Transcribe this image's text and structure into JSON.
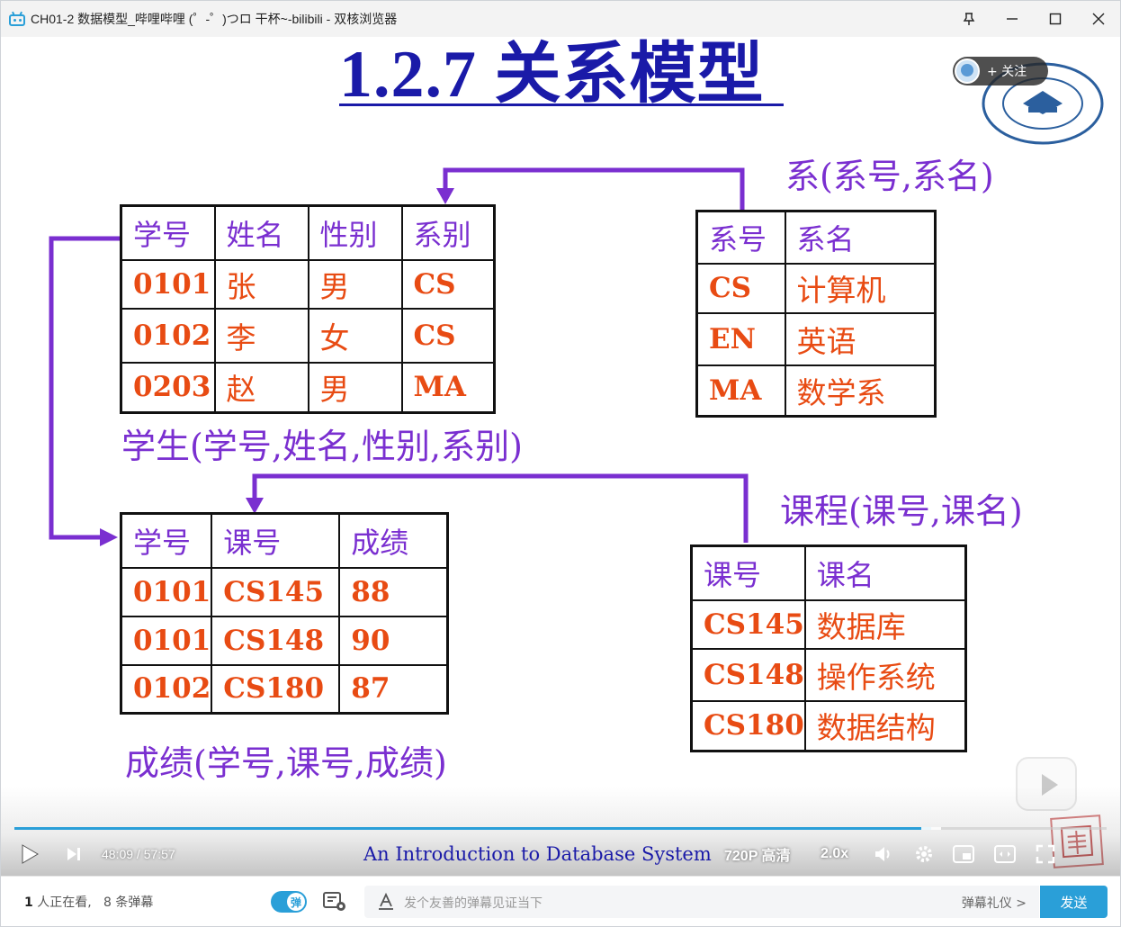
{
  "window": {
    "title": "CH01-2 数据模型_哔哩哔哩 (゜-゜)つロ 干杯~-bilibili - 双核浏览器",
    "controls": {
      "pin": "pin-icon",
      "minimize": "minimize-icon",
      "maximize": "maximize-icon",
      "close": "close-icon"
    }
  },
  "slide": {
    "title": "1.2.7 关系模型",
    "relations": {
      "dept": {
        "label": "系(系号,系名)",
        "headers": [
          "系号",
          "系名"
        ],
        "rows": [
          [
            "CS",
            "计算机"
          ],
          [
            "EN",
            "英语"
          ],
          [
            "MA",
            "数学系"
          ]
        ]
      },
      "student": {
        "label": "学生(学号,姓名,性别,系别)",
        "headers": [
          "学号",
          "姓名",
          "性别",
          "系别"
        ],
        "rows": [
          [
            "0101",
            "张",
            "男",
            "CS"
          ],
          [
            "0102",
            "李",
            "女",
            "CS"
          ],
          [
            "0203",
            "赵",
            "男",
            "MA"
          ]
        ]
      },
      "grade": {
        "label": "成绩(学号,课号,成绩)",
        "headers": [
          "学号",
          "课号",
          "成绩"
        ],
        "rows": [
          [
            "0101",
            "CS145",
            "88"
          ],
          [
            "0101",
            "CS148",
            "90"
          ],
          [
            "0102",
            "CS180",
            "87"
          ]
        ]
      },
      "course": {
        "label": "课程(课号,课名)",
        "headers": [
          "课号",
          "课名"
        ],
        "rows": [
          [
            "CS145",
            "数据库"
          ],
          [
            "CS148",
            "操作系统"
          ],
          [
            "CS180",
            "数据结构"
          ]
        ]
      }
    },
    "arrow_color": "#7a2fd0"
  },
  "follow": {
    "label": "+ 关注"
  },
  "player": {
    "progress": 0.839,
    "current_time": "48:09",
    "duration": "57:57",
    "time_display": "48:09 / 57:57",
    "subtitle": "An Introduction to Database System",
    "quality": "720P 高清",
    "speed": "2.0x",
    "accent": "#2a9fd8"
  },
  "bottom": {
    "viewers_count": "1",
    "viewers_suffix": "人正在看,",
    "danmaku_count": "8",
    "danmaku_suffix": "条弹幕",
    "toggle_label": "弹",
    "input_placeholder": "发个友善的弹幕见证当下",
    "etiquette_link": "弹幕礼仪 >",
    "send_label": "发送"
  }
}
